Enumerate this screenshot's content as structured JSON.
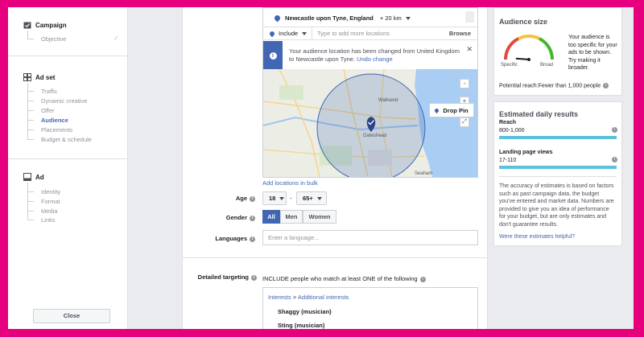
{
  "sidebar": {
    "campaign": {
      "title": "Campaign",
      "items": [
        "Objective"
      ]
    },
    "adset": {
      "title": "Ad set",
      "items": [
        "Traffic",
        "Dynamic creative",
        "Offer",
        "Audience",
        "Placements",
        "Budget & schedule"
      ],
      "active": "Audience"
    },
    "ad": {
      "title": "Ad",
      "items": [
        "Identity",
        "Format",
        "Media",
        "Links"
      ]
    },
    "close_label": "Close"
  },
  "location": {
    "title": "Newcastle upon Tyne, England",
    "radius": "+ 20 km",
    "include_label": "Include",
    "add_placeholder": "Type to add more locations",
    "browse_label": "Browse",
    "notice_text": "Your audience location has been changed from United Kingdom to Newcastle upon Tyne.",
    "notice_link": "Undo change",
    "map_labels": [
      "Wallsend",
      "Gateshead",
      "Seaham"
    ],
    "drop_pin_label": "Drop Pin",
    "add_bulk_label": "Add locations in bulk"
  },
  "age": {
    "label": "Age",
    "min": "18",
    "separator": "-",
    "max": "65+"
  },
  "gender": {
    "label": "Gender",
    "options": [
      "All",
      "Men",
      "Women"
    ],
    "selected": "All"
  },
  "languages": {
    "label": "Languages",
    "placeholder": "Enter a language..."
  },
  "detailed_targeting": {
    "label": "Detailed targeting",
    "include_text": "INCLUDE people who match at least ONE of the following",
    "breadcrumb": [
      "Interests",
      "Additional interests"
    ],
    "breadcrumb_sep": ">",
    "interests": [
      "Shaggy (musician)",
      "Sting (musician)"
    ]
  },
  "audience_size": {
    "title": "Audience size",
    "gauge_low": "Specific",
    "gauge_high": "Broad",
    "gauge_level": 0.2,
    "message": "Your audience is too specific for your ads to be shown. Try making it broader.",
    "potential_reach_label": "Potential reach:",
    "potential_reach_value": "Fewer than 1,000 people"
  },
  "daily_results": {
    "title": "Estimated daily results",
    "reach_label": "Reach",
    "reach_value": "800-1,000",
    "lpv_label": "Landing page views",
    "lpv_value": "17-110",
    "disclaimer": "The accuracy of estimates is based on factors such as past campaign data, the budget you've entered and market data. Numbers are provided to give you an idea of performance for your budget, but are only estimates and don't guarantee results.",
    "helpful_link": "Were these estimates helpful?"
  },
  "colors": {
    "accent": "#4267b2",
    "bar": "#5bc1dc",
    "frame": "#e6007e",
    "gauge_red": "#e04a3f",
    "gauge_green": "#42b72a"
  }
}
